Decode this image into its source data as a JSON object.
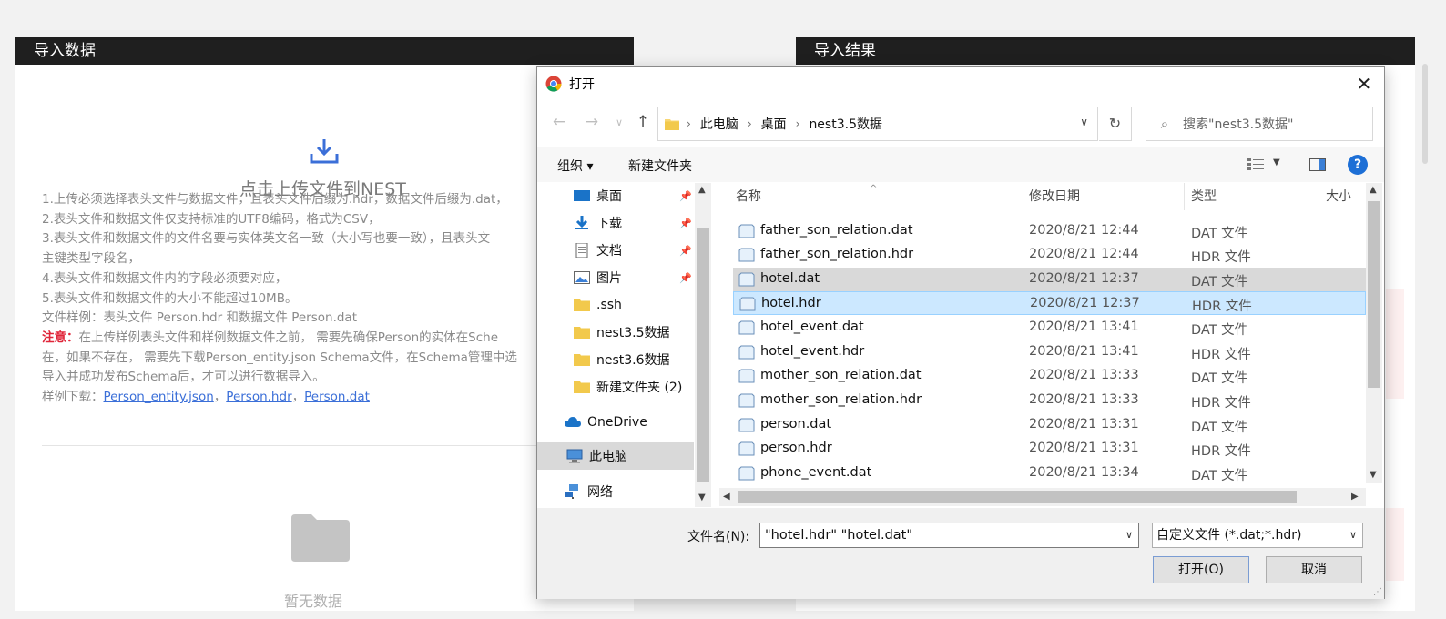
{
  "left_panel": {
    "header": "导入数据",
    "upload_title": "点击上传文件到NEST",
    "notes": [
      "1.上传必须选择表头文件与数据文件，且表头文件后缀为.hdr，数据文件后缀为.dat，",
      "2.表头文件和数据文件仅支持标准的UTF8编码，格式为CSV，",
      "3.表头文件和数据文件的文件名要与实体英文名一致（大小写也要一致），且表头文",
      "主键类型字段名，",
      "4.表头文件和数据文件内的字段必须要对应，",
      "5.表头文件和数据文件的大小不能超过10MB。",
      "文件样例：表头文件 Person.hdr 和数据文件 Person.dat"
    ],
    "warn_label": "注意：",
    "warn_text_1": "在上传样例表头文件和样例数据文件之前， 需要先确保Person的实体在Sche",
    "warn_text_2": "在，如果不存在， 需要先下载Person_entity.json Schema文件，在Schema管理中选",
    "warn_text_3": "导入并成功发布Schema后，才可以进行数据导入。",
    "sample_label": "样例下载：",
    "sample_links": [
      "Person_entity.json",
      "Person.hdr",
      "Person.dat"
    ],
    "sample_sep": "，",
    "nodata": "暂无数据"
  },
  "right_panel": {
    "header": "导入结果"
  },
  "dialog": {
    "title": "打开",
    "address": [
      "此电脑",
      "桌面",
      "nest3.5数据"
    ],
    "search_placeholder": "搜索\"nest3.5数据\"",
    "toolbar": {
      "organize": "组织 ▾",
      "new_folder": "新建文件夹"
    },
    "nav_items": [
      {
        "label": "桌面",
        "pinned": true
      },
      {
        "label": "下载",
        "pinned": true
      },
      {
        "label": "文档",
        "pinned": true
      },
      {
        "label": "图片",
        "pinned": true
      },
      {
        "label": ".ssh"
      },
      {
        "label": "nest3.5数据"
      },
      {
        "label": "nest3.6数据"
      },
      {
        "label": "新建文件夹 (2)"
      },
      {
        "label": "OneDrive"
      },
      {
        "label": "此电脑"
      },
      {
        "label": "网络"
      }
    ],
    "columns": {
      "name": "名称",
      "date": "修改日期",
      "type": "类型",
      "size": "大小"
    },
    "files": [
      {
        "name": "father_son_relation.dat",
        "date": "2020/8/21 12:44",
        "type": "DAT 文件"
      },
      {
        "name": "father_son_relation.hdr",
        "date": "2020/8/21 12:44",
        "type": "HDR 文件"
      },
      {
        "name": "hotel.dat",
        "date": "2020/8/21 12:37",
        "type": "DAT 文件"
      },
      {
        "name": "hotel.hdr",
        "date": "2020/8/21 12:37",
        "type": "HDR 文件"
      },
      {
        "name": "hotel_event.dat",
        "date": "2020/8/21 13:41",
        "type": "DAT 文件"
      },
      {
        "name": "hotel_event.hdr",
        "date": "2020/8/21 13:41",
        "type": "HDR 文件"
      },
      {
        "name": "mother_son_relation.dat",
        "date": "2020/8/21 13:33",
        "type": "DAT 文件"
      },
      {
        "name": "mother_son_relation.hdr",
        "date": "2020/8/21 13:33",
        "type": "HDR 文件"
      },
      {
        "name": "person.dat",
        "date": "2020/8/21 13:31",
        "type": "DAT 文件"
      },
      {
        "name": "person.hdr",
        "date": "2020/8/21 13:31",
        "type": "HDR 文件"
      },
      {
        "name": "phone_event.dat",
        "date": "2020/8/21 13:34",
        "type": "DAT 文件"
      }
    ],
    "filename_label": "文件名(N):",
    "filename_value": "\"hotel.hdr\" \"hotel.dat\"",
    "filetype_value": "自定义文件 (*.dat;*.hdr)",
    "open_button": "打开(O)",
    "cancel_button": "取消"
  }
}
